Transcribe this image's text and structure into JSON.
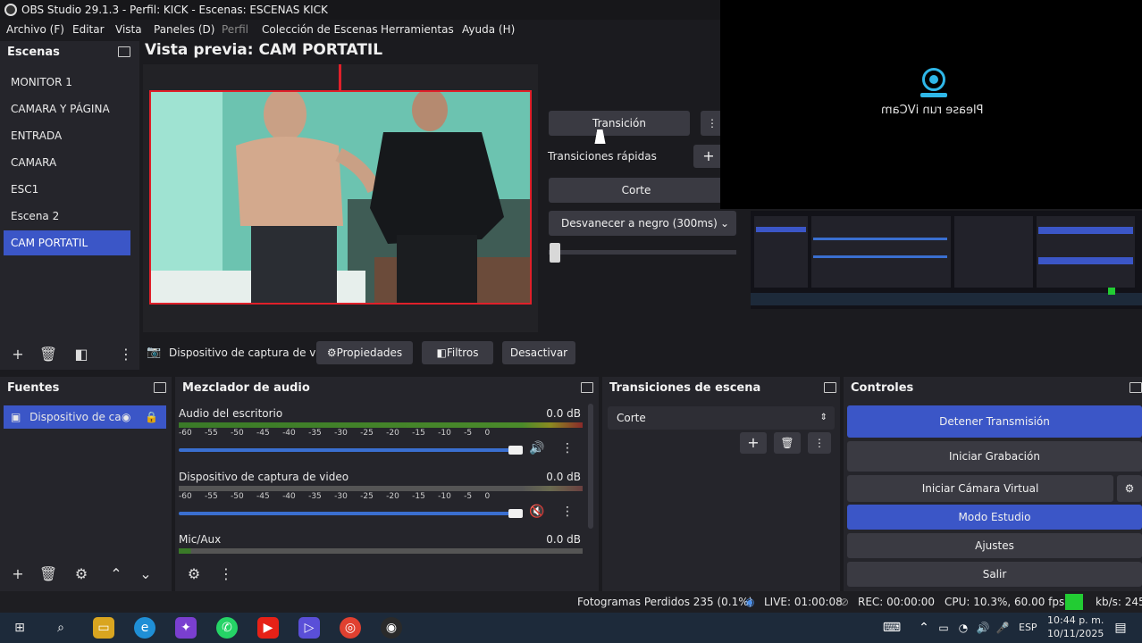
{
  "window": {
    "title": "OBS Studio 29.1.3 - Perfil: KICK - Escenas: ESCENAS KICK"
  },
  "menu": [
    "Archivo (F)",
    "Editar",
    "Vista",
    "Paneles (D)",
    "Perfil",
    "Colección de Escenas",
    "Herramientas",
    "Ayuda (H)"
  ],
  "scenes": {
    "title": "Escenas",
    "items": [
      "MONITOR 1",
      "CAMARA Y PÁGINA",
      "ENTRADA",
      "CAMARA",
      "ESC1",
      "Escena 2",
      "CAM PORTATIL"
    ],
    "active_index": 6
  },
  "preview": {
    "title": "Vista previa: CAM PORTATIL"
  },
  "transition_panel": {
    "transition_button": "Transición",
    "quick_label": "Transiciones rápidas",
    "cut_button": "Corte",
    "fade_select": "Desvanecer a negro (300ms)"
  },
  "ivcam": {
    "message": "Please run iVCam"
  },
  "source_toolbar": {
    "source_name": "Dispositivo de captura de v",
    "properties": "Propiedades",
    "filters": "Filtros",
    "deactivate": "Desactivar"
  },
  "sources": {
    "title": "Fuentes",
    "items": [
      "Dispositivo de ca"
    ]
  },
  "mixer": {
    "title": "Mezclador de audio",
    "ticks": [
      "-60",
      "-55",
      "-50",
      "-45",
      "-40",
      "-35",
      "-30",
      "-25",
      "-20",
      "-15",
      "-10",
      "-5",
      "0"
    ],
    "channels": [
      {
        "name": "Audio del escritorio",
        "db": "0.0 dB",
        "volume": 1.0,
        "muted": false
      },
      {
        "name": "Dispositivo de captura de video",
        "db": "0.0 dB",
        "volume": 1.0,
        "muted": true
      },
      {
        "name": "Mic/Aux",
        "db": "0.0 dB",
        "volume": 1.0,
        "muted": false
      }
    ]
  },
  "scene_transitions": {
    "title": "Transiciones de escena",
    "selected": "Corte"
  },
  "controls": {
    "title": "Controles",
    "stop_stream": "Detener Transmisión",
    "start_record": "Iniciar Grabación",
    "start_vcam": "Iniciar Cámara Virtual",
    "studio_mode": "Modo Estudio",
    "settings": "Ajustes",
    "exit": "Salir"
  },
  "status": {
    "dropped": "Fotogramas Perdidos 235 (0.1%)",
    "live": "LIVE: 01:00:08",
    "rec": "REC: 00:00:00",
    "cpu": "CPU: 10.3%, 60.00 fps",
    "kbs": "kb/s: 245"
  },
  "taskbar": {
    "lang": "ESP",
    "time": "10:44 p. m.",
    "date": "10/11/2025"
  },
  "colors": {
    "accent": "#3b56c7",
    "live_green": "#22cc33",
    "red_border": "#e0202a"
  }
}
